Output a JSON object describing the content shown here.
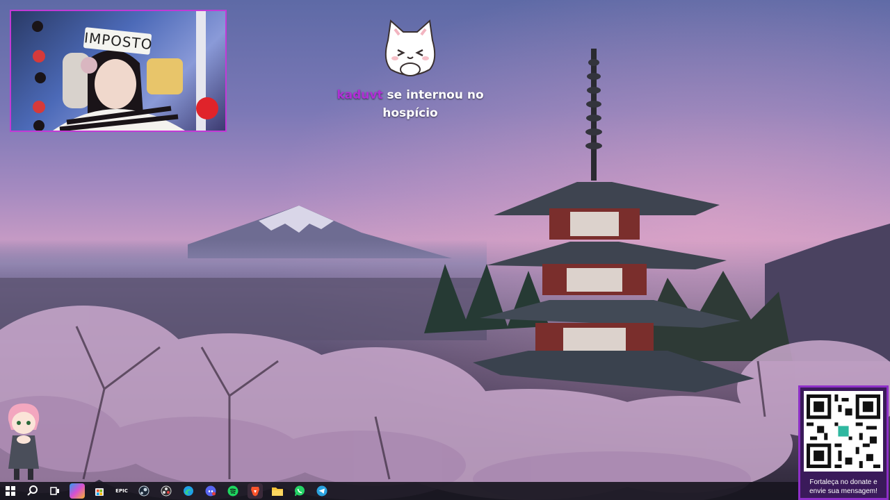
{
  "alert": {
    "username": "kaduvt",
    "message_line1": "se internou no",
    "message_line2": "hospício",
    "cat_icon": "cat-sticker"
  },
  "webcam": {
    "sign_text": "IMPOSTO",
    "frame_color": "#c23ad6"
  },
  "qr_panel": {
    "caption_line1": "Fortaleça no donate e",
    "caption_line2": "envie sua mensagem!",
    "border_color": "#8e2fc8"
  },
  "taskbar": {
    "icons": [
      "windows-start-icon",
      "search-icon",
      "task-view-icon",
      "copilot-icon",
      "microsoft-store-icon",
      "epic-games-icon",
      "steam-icon",
      "obs-icon",
      "edge-icon",
      "discord-icon",
      "spotify-icon",
      "brave-icon",
      "file-explorer-icon",
      "whatsapp-icon",
      "telegram-icon"
    ],
    "epic_label": "EPIC"
  },
  "colors": {
    "alert_username": "#b02fd6",
    "taskbar_bg": "#18161f"
  }
}
